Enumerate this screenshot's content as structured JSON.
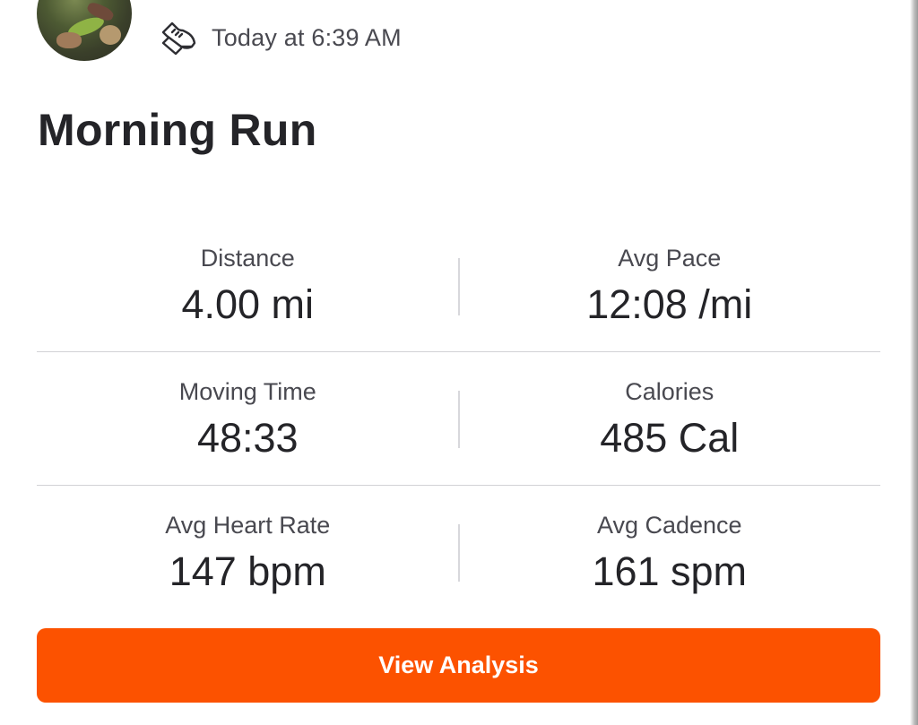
{
  "activity": {
    "timestamp": "Today at 6:39 AM",
    "title": "Morning Run",
    "sport_icon": "running-shoe-icon",
    "avatar": "athlete-avatar-photo"
  },
  "stats": [
    {
      "left": {
        "label": "Distance",
        "value": "4.00 mi"
      },
      "right": {
        "label": "Avg Pace",
        "value": "12:08 /mi"
      }
    },
    {
      "left": {
        "label": "Moving Time",
        "value": "48:33"
      },
      "right": {
        "label": "Calories",
        "value": "485 Cal"
      }
    },
    {
      "left": {
        "label": "Avg Heart Rate",
        "value": "147 bpm"
      },
      "right": {
        "label": "Avg Cadence",
        "value": "161 spm"
      }
    }
  ],
  "button": {
    "label": "View Analysis"
  },
  "colors": {
    "accent": "#fc5200",
    "text_primary": "#242428",
    "text_secondary": "#494950",
    "divider": "#d2d2d6"
  }
}
